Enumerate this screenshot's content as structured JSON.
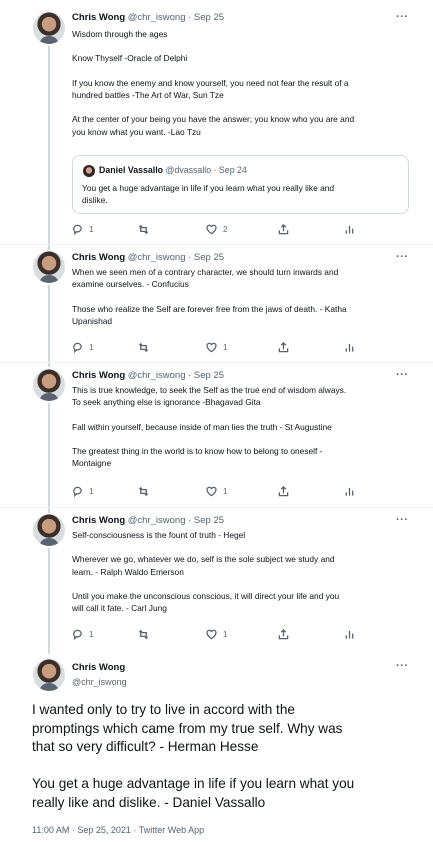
{
  "tweets": [
    {
      "name": "Chris Wong",
      "meta": "@chr_iswong · Sep 25",
      "more": "···",
      "lines": [
        "Wisdom through the ages",
        "",
        "Know Thyself -Oracle of Delphi",
        "",
        "If you know the enemy and know yourself, you need not fear the result of a",
        "hundred battles -The Art of War, Sun Tze",
        "",
        "At the center of your being you have the answer; you know who you are and",
        "you know what you want. -Lao Tzu"
      ],
      "quote": {
        "name": "Daniel Vassallo",
        "meta": "@dvassallo · Sep 24",
        "lines": [
          "You get a huge advantage in life if you learn what you really like and",
          "dislike."
        ]
      },
      "actions": {
        "reply": "1",
        "retweet": "",
        "like": "2",
        "share": "",
        "analytics": ""
      }
    },
    {
      "name": "Chris Wong",
      "meta": "@chr_iswong · Sep 25",
      "more": "···",
      "lines": [
        "When we seen men of a contrary character, we should turn inwards and",
        "examine ourselves. - Confucius",
        "",
        " Those who realize the Self are forever free from the jaws of death. - Katha",
        "Upanishad"
      ],
      "actions": {
        "reply": "1",
        "retweet": "",
        "like": "1",
        "share": "",
        "analytics": ""
      }
    },
    {
      "name": "Chris Wong",
      "meta": "@chr_iswong · Sep 25",
      "more": "···",
      "lines": [
        "This is true knowledge, to seek the Self as the true end of wisdom always.",
        "To seek anything else is ignorance -Bhagavad Gita",
        "",
        "Fall within yourself, because inside of man lies the truth - St Augustine",
        "",
        "The greatest thing in the world is to know how to belong to oneself -",
        "Montaigne"
      ],
      "actions": {
        "reply": "1",
        "retweet": "",
        "like": "1",
        "share": "",
        "analytics": ""
      }
    },
    {
      "name": "Chris Wong",
      "meta": "@chr_iswong · Sep 25",
      "more": "···",
      "lines": [
        "Self-consciousness is the fount of truth - Hegel",
        "",
        "Wherever we go, whatever we do, self is the sole subject we study and",
        "learn.  - Ralph Waldo Emerson",
        "",
        "Until you make the unconscious conscious, it will direct your life and you",
        "will call it fate. - Carl Jung"
      ],
      "actions": {
        "reply": "1",
        "retweet": "",
        "like": "1",
        "share": "",
        "analytics": ""
      }
    }
  ],
  "main": {
    "name": "Chris Wong",
    "handle": "@chr_iswong",
    "more": "···",
    "lines": [
      "I wanted only to try to live in accord with the",
      "promptings which came from my true self. Why was",
      "that so very difficult? - Herman Hesse",
      "",
      "You get a huge advantage in life if you learn what you",
      "really like and dislike. - Daniel Vassallo"
    ],
    "footer": "11:00 AM · Sep 25, 2021 · Twitter Web App"
  }
}
